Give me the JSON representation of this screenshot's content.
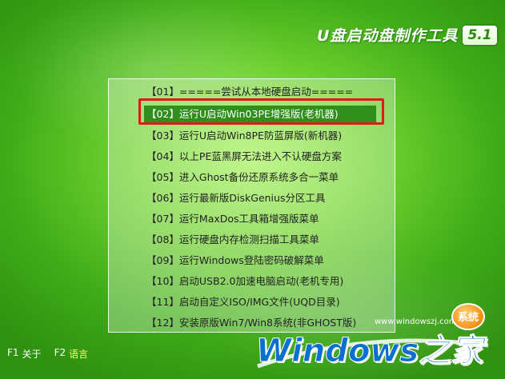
{
  "header": {
    "title": "U盘启动盘制作工具",
    "version": "5.1"
  },
  "menu": {
    "selected_index": 1,
    "items": [
      {
        "label": "【01】=====尝试从本地硬盘启动====="
      },
      {
        "label": "【02】运行U启动Win03PE增强版(老机器)"
      },
      {
        "label": "【03】运行U启动Win8PE防蓝屏版(新机器)"
      },
      {
        "label": "【04】以上PE蓝黑屏无法进入不认硬盘方案"
      },
      {
        "label": "【05】进入Ghost备份还原系统多合一菜单"
      },
      {
        "label": "【06】运行最新版DiskGenius分区工具"
      },
      {
        "label": "【07】运行MaxDos工具箱增强版菜单"
      },
      {
        "label": "【08】运行硬盘内存检测扫描工具菜单"
      },
      {
        "label": "【09】运行Windows登陆密码破解菜单"
      },
      {
        "label": "【10】启动USB2.0加速电脑启动(老机专用)"
      },
      {
        "label": "【11】启动自定义ISO/IMG文件(UQD目录)"
      },
      {
        "label": "【12】安装原版Win7/Win8系统(非GHOST版)"
      }
    ]
  },
  "footer": {
    "f1_key": "F1",
    "f1_label": "关于",
    "f2_key": "F2",
    "f2_label": "语言"
  },
  "watermark": {
    "url": "www.windowszj.com",
    "badge": "系统",
    "logo_text": "Windows之家"
  },
  "colors": {
    "background": "#5cc526",
    "selected_bg": "#2f8f1a",
    "highlight_border": "#e0191c",
    "fkey_label": "#ffff66"
  }
}
